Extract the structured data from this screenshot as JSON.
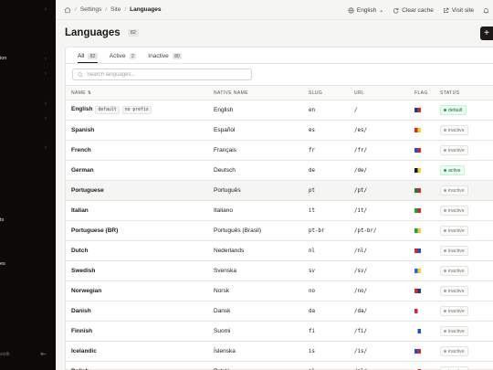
{
  "sidebar": {
    "labels": [
      "ion",
      "ts",
      "es"
    ],
    "footer_text": "ssdb"
  },
  "breadcrumb": {
    "items": [
      "Settings",
      "Site",
      "Languages"
    ]
  },
  "topbar": {
    "language": "English",
    "clear_cache": "Clear cache",
    "visit_site": "Visit site"
  },
  "page": {
    "title": "Languages",
    "count": "82"
  },
  "tabs": [
    {
      "label": "All",
      "count": "82"
    },
    {
      "label": "Active",
      "count": "2"
    },
    {
      "label": "Inactive",
      "count": "80"
    }
  ],
  "search": {
    "placeholder": "Search languages..."
  },
  "table": {
    "headers": {
      "name": "NAME ⇅",
      "native": "NATIVE NAME",
      "slug": "SLUG",
      "url": "URL",
      "flag": "FLAG",
      "status": "STATUS"
    },
    "rows": [
      {
        "name": "English",
        "tags": [
          "default",
          "no prefix"
        ],
        "native": "English",
        "slug": "en",
        "url": "/",
        "flag": [
          "#1e3a8a",
          "#dc2626"
        ],
        "status": "default",
        "active": true
      },
      {
        "name": "Spanish",
        "native": "Español",
        "slug": "es",
        "url": "/es/",
        "flag": [
          "#dc2626",
          "#facc15"
        ],
        "status": "inactive",
        "active": false
      },
      {
        "name": "French",
        "native": "Français",
        "slug": "fr",
        "url": "/fr/",
        "flag": [
          "#1d4ed8",
          "#dc2626"
        ],
        "status": "inactive",
        "active": false
      },
      {
        "name": "German",
        "native": "Deutsch",
        "slug": "de",
        "url": "/de/",
        "flag": [
          "#111827",
          "#facc15"
        ],
        "status": "active",
        "active": true
      },
      {
        "name": "Portuguese",
        "native": "Português",
        "slug": "pt",
        "url": "/pt/",
        "flag": [
          "#15803d",
          "#dc2626"
        ],
        "status": "inactive",
        "active": false
      },
      {
        "name": "Italian",
        "native": "Italiano",
        "slug": "it",
        "url": "/it/",
        "flag": [
          "#16a34a",
          "#dc2626"
        ],
        "status": "inactive",
        "active": false
      },
      {
        "name": "Portuguese (BR)",
        "native": "Português (Brasil)",
        "slug": "pt-br",
        "url": "/pt-br/",
        "flag": [
          "#16a34a",
          "#facc15"
        ],
        "status": "inactive",
        "active": false
      },
      {
        "name": "Dutch",
        "native": "Nederlands",
        "slug": "nl",
        "url": "/nl/",
        "flag": [
          "#dc2626",
          "#1d4ed8"
        ],
        "status": "inactive",
        "active": false
      },
      {
        "name": "Swedish",
        "native": "Svenska",
        "slug": "sv",
        "url": "/sv/",
        "flag": [
          "#2563eb",
          "#facc15"
        ],
        "status": "inactive",
        "active": false
      },
      {
        "name": "Norwegian",
        "native": "Norsk",
        "slug": "no",
        "url": "/no/",
        "flag": [
          "#dc2626",
          "#1e3a8a"
        ],
        "status": "inactive",
        "active": false
      },
      {
        "name": "Danish",
        "native": "Dansk",
        "slug": "da",
        "url": "/da/",
        "flag": [
          "#dc2626",
          "#ffffff"
        ],
        "status": "inactive",
        "active": false
      },
      {
        "name": "Finnish",
        "native": "Suomi",
        "slug": "fi",
        "url": "/fi/",
        "flag": [
          "#ffffff",
          "#1d4ed8"
        ],
        "status": "inactive",
        "active": false
      },
      {
        "name": "Icelandic",
        "native": "Íslenska",
        "slug": "is",
        "url": "/is/",
        "flag": [
          "#1d4ed8",
          "#dc2626"
        ],
        "status": "inactive",
        "active": false
      },
      {
        "name": "Polish",
        "native": "Polski",
        "slug": "pl",
        "url": "/pl/",
        "flag": [
          "#ffffff",
          "#dc2626"
        ],
        "status": "inactive",
        "active": false
      }
    ]
  }
}
